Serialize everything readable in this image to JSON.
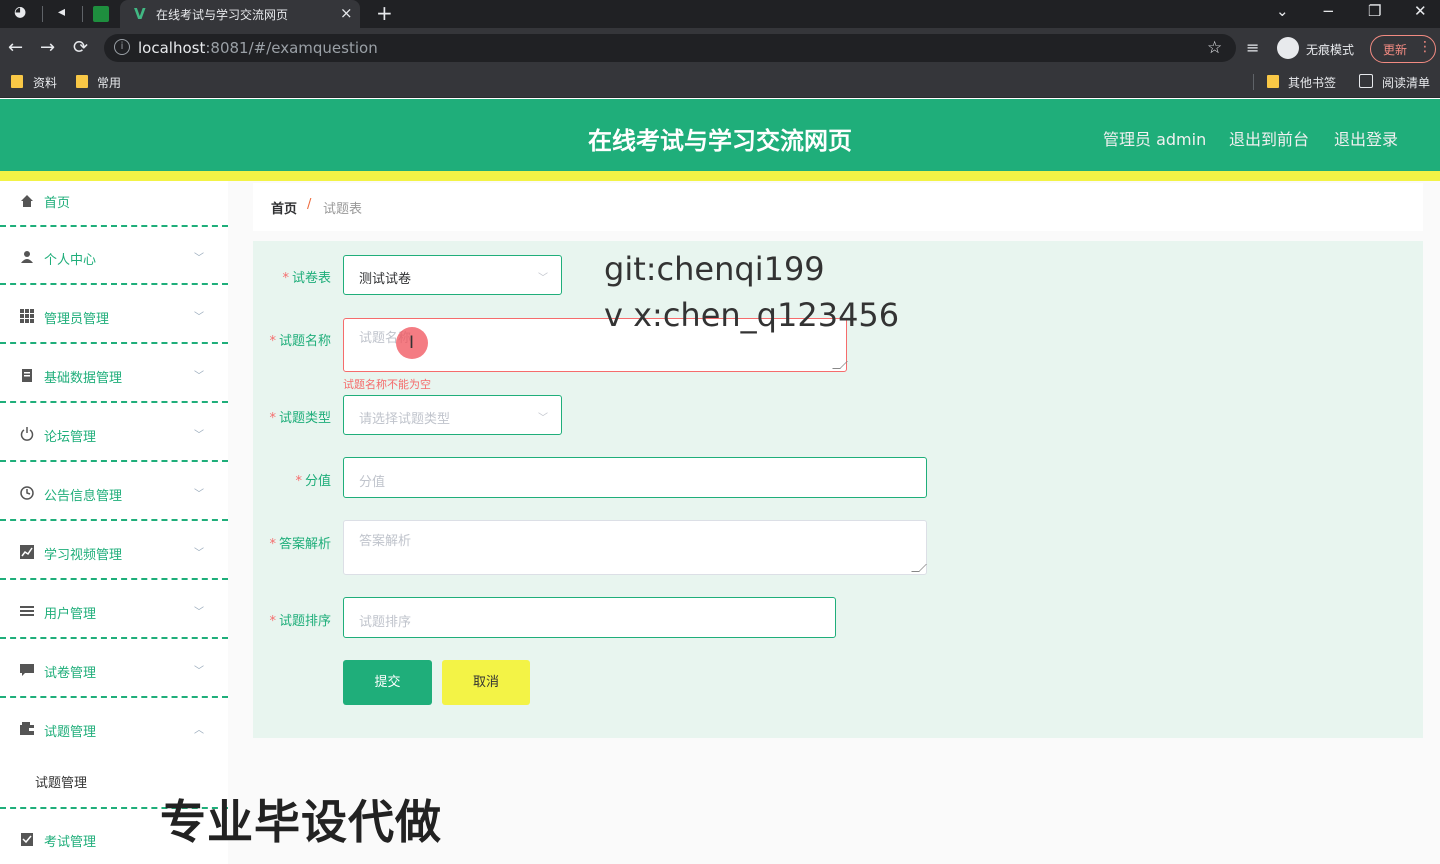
{
  "browser": {
    "tab_title": "在线考试与学习交流网页",
    "tab_favicon": "V",
    "tab_close": "×",
    "new_tab": "+",
    "url_host": "localhost",
    "url_rest": ":8081/#/examquestion",
    "incognito_label": "无痕模式",
    "update_label": "更新",
    "bookmarks": {
      "left": [
        "资料",
        "常用"
      ],
      "right": [
        "其他书签",
        "阅读清单"
      ]
    },
    "window_controls": {
      "chevron": "⌄",
      "minimize": "−",
      "restore": "❐",
      "close": "✕"
    },
    "nav": {
      "back": "←",
      "forward": "→",
      "reload": "⟳"
    }
  },
  "header": {
    "title": "在线考试与学习交流网页",
    "admin_label": "管理员 admin",
    "front_link": "退出到前台",
    "logout_link": "退出登录",
    "bg_color": "#1fae7a",
    "strip_color": "#f3f346"
  },
  "sidebar": {
    "items": [
      {
        "label": "首页",
        "icon": "home-icon"
      },
      {
        "label": "个人中心",
        "icon": "user-icon"
      },
      {
        "label": "管理员管理",
        "icon": "grid-icon"
      },
      {
        "label": "基础数据管理",
        "icon": "clipboard-icon"
      },
      {
        "label": "论坛管理",
        "icon": "power-icon"
      },
      {
        "label": "公告信息管理",
        "icon": "clock-icon"
      },
      {
        "label": "学习视频管理",
        "icon": "chart-icon"
      },
      {
        "label": "用户管理",
        "icon": "menu-icon"
      },
      {
        "label": "试卷管理",
        "icon": "chat-icon"
      },
      {
        "label": "试题管理",
        "icon": "wallet-icon"
      },
      {
        "label": "考试管理",
        "icon": "checklist-icon"
      }
    ],
    "submenu_item": "试题管理"
  },
  "breadcrumb": {
    "home": "首页",
    "separator": "/",
    "current": "试题表"
  },
  "form": {
    "paper_label": "试卷表",
    "paper_value": "测试试卷",
    "name_label": "试题名称",
    "name_placeholder": "试题名称",
    "name_error": "试题名称不能为空",
    "type_label": "试题类型",
    "type_placeholder": "请选择试题类型",
    "score_label": "分值",
    "score_placeholder": "分值",
    "analysis_label": "答案解析",
    "analysis_placeholder": "答案解析",
    "order_label": "试题排序",
    "order_placeholder": "试题排序",
    "required_mark": "*",
    "submit": "提交",
    "cancel": "取消"
  },
  "overlays": {
    "git": "git:chenqi199",
    "vx": "v x:chen_q123456",
    "promo": "专业毕设代做"
  }
}
